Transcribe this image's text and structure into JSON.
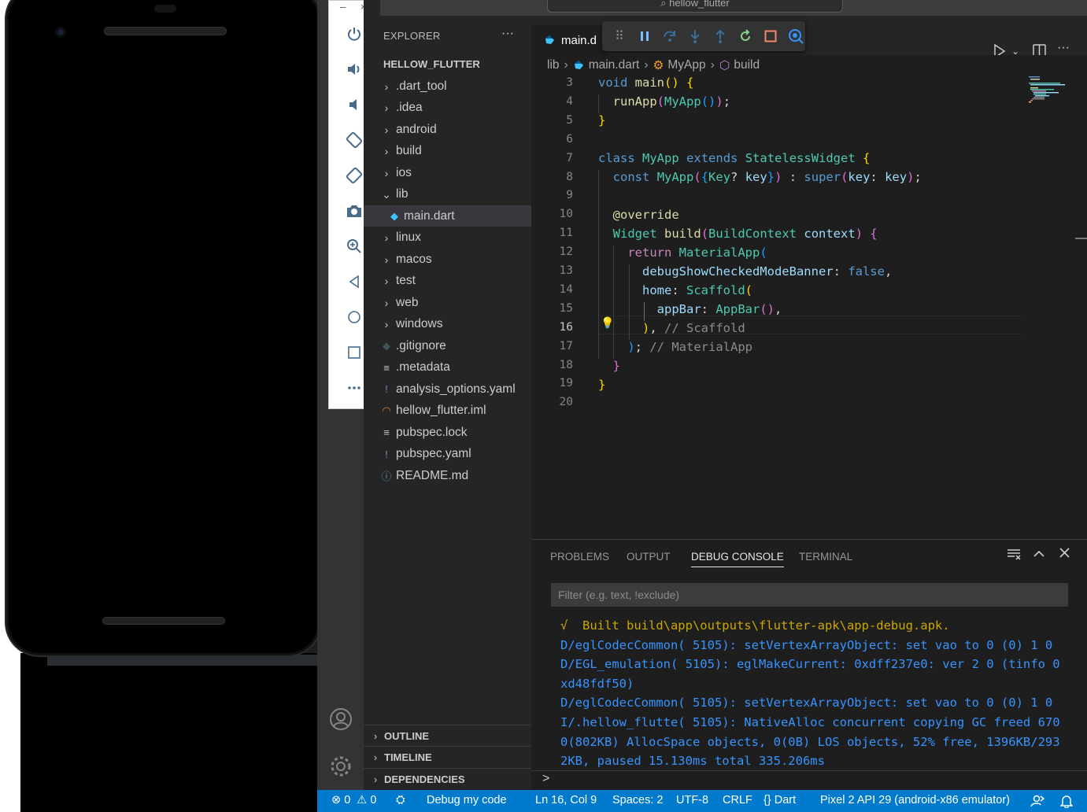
{
  "emulator": {
    "toolbar_buttons": [
      "power-icon",
      "volume-up-icon",
      "volume-down-icon",
      "rotate-left-icon",
      "rotate-right-icon",
      "camera-icon",
      "zoom-icon",
      "back-icon",
      "home-icon",
      "overview-icon",
      "more-icon"
    ],
    "minimize": "–",
    "close": "×"
  },
  "titlebar": {
    "search": "hellow_flutter"
  },
  "sidebar": {
    "title": "EXPLORER",
    "more": "···",
    "project": "HELLOW_FLUTTER",
    "items": [
      {
        "label": ".dart_tool",
        "type": "folder"
      },
      {
        "label": ".idea",
        "type": "folder"
      },
      {
        "label": "android",
        "type": "folder"
      },
      {
        "label": "build",
        "type": "folder"
      },
      {
        "label": "ios",
        "type": "folder"
      },
      {
        "label": "lib",
        "type": "folder-open"
      },
      {
        "label": "main.dart",
        "type": "dart"
      },
      {
        "label": "linux",
        "type": "folder"
      },
      {
        "label": "macos",
        "type": "folder"
      },
      {
        "label": "test",
        "type": "folder"
      },
      {
        "label": "web",
        "type": "folder"
      },
      {
        "label": "windows",
        "type": "folder"
      },
      {
        "label": ".gitignore",
        "type": "git"
      },
      {
        "label": ".metadata",
        "type": "text"
      },
      {
        "label": "analysis_options.yaml",
        "type": "yaml"
      },
      {
        "label": "hellow_flutter.iml",
        "type": "rss"
      },
      {
        "label": "pubspec.lock",
        "type": "text"
      },
      {
        "label": "pubspec.yaml",
        "type": "yaml"
      },
      {
        "label": "README.md",
        "type": "info"
      }
    ],
    "sections": [
      "OUTLINE",
      "TIMELINE",
      "DEPENDENCIES"
    ]
  },
  "editor": {
    "tab": "main.d",
    "breadcrumb": [
      "lib",
      "main.dart",
      "MyApp",
      "build"
    ],
    "line_numbers": [
      "3",
      "4",
      "5",
      "6",
      "7",
      "8",
      "9",
      "10",
      "11",
      "12",
      "13",
      "14",
      "15",
      "16",
      "17",
      "18",
      "19",
      "20"
    ],
    "active_line": "16"
  },
  "panel": {
    "tabs": [
      "PROBLEMS",
      "OUTPUT",
      "DEBUG CONSOLE",
      "TERMINAL"
    ],
    "active_tab": "DEBUG CONSOLE",
    "filter_placeholder": "Filter (e.g. text, !exclude)",
    "console_lines": [
      "√  Built build\\app\\outputs\\flutter-apk\\app-debug.apk.",
      "D/eglCodecCommon( 5105): setVertexArrayObject: set vao to 0 (0) 1 0",
      "D/EGL_emulation( 5105): eglMakeCurrent: 0xdff237e0: ver 2 0 (tinfo 0",
      "xd48fdf50)",
      "D/eglCodecCommon( 5105): setVertexArrayObject: set vao to 0 (0) 1 0",
      "I/.hellow_flutte( 5105): NativeAlloc concurrent copying GC freed 670",
      "0(802KB) AllocSpace objects, 0(0B) LOS objects, 52% free, 1396KB/293",
      "2KB, paused 15.130ms total 335.206ms"
    ],
    "prompt": ">"
  },
  "statusbar": {
    "errors": "0",
    "warnings": "0",
    "debug": "Debug my code",
    "position": "Ln 16, Col 9",
    "spaces": "Spaces: 2",
    "encoding": "UTF-8",
    "eol": "CRLF",
    "language": "Dart",
    "device": "Pixel 2 API 29 (android-x86 emulator)"
  },
  "colors": {
    "statusbar": "#007acc",
    "activity": "#333333",
    "sidebar": "#252526",
    "editor": "#1e1e1e"
  }
}
